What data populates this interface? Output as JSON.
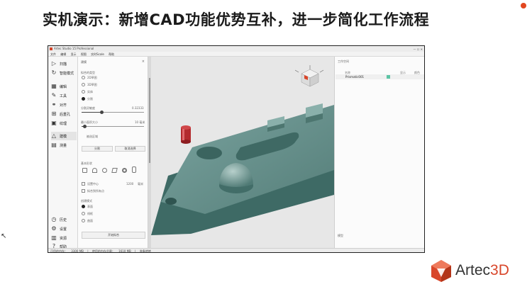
{
  "slide": {
    "title": "实机演示：新增CAD功能优势互补，进一步简化工作流程"
  },
  "app": {
    "window_title": "Artec Studio 15 Professional",
    "window_controls": "— ☐ ✕",
    "menu": [
      "文件",
      "编辑",
      "显示",
      "视图",
      "实时Scale",
      "帮助"
    ]
  },
  "toolbar": {
    "items": [
      {
        "label": "扫描",
        "icon": "play-icon"
      },
      {
        "label": "智能模式",
        "icon": "autopilot-icon"
      },
      {
        "label": "编辑",
        "icon": "edit-icon"
      },
      {
        "label": "工具",
        "icon": "tools-icon"
      },
      {
        "label": "对齐",
        "icon": "align-icon"
      },
      {
        "label": "后重孔",
        "icon": "fill-holes-icon"
      },
      {
        "label": "纹理",
        "icon": "texture-icon"
      },
      {
        "label": "建模",
        "icon": "cad-icon"
      },
      {
        "label": "测量",
        "icon": "measure-icon"
      },
      {
        "label": "历史",
        "icon": "history-icon"
      },
      {
        "label": "设置",
        "icon": "settings-icon"
      },
      {
        "label": "资源",
        "icon": "resources-icon"
      },
      {
        "label": "帮助",
        "icon": "help-icon"
      }
    ]
  },
  "panel": {
    "header": "建模",
    "close": "×",
    "section_mode": "拟合的类型",
    "modes": [
      "2D草图",
      "3D草图",
      "实体",
      "分割"
    ],
    "slider1_label": "分割灵敏度",
    "slider1_value": "0.32333",
    "slider1_fraction": 0.32,
    "slider2_label": "最小面积大小",
    "slider2_value": "10 毫米",
    "slider2_fraction": 0.05,
    "section_small": "被选区域",
    "btn_left": "分割",
    "btn_right": "取消选择",
    "section_shapes": "基本形状",
    "chk1_label": "设置中心",
    "chk1_value": "1200",
    "chk1_unit": "毫米",
    "chk2_label": "拟合到所有点",
    "section_create": "创建模式",
    "create_modes": [
      "表面",
      "线框",
      "曲面"
    ],
    "apply_button": "开始拟合"
  },
  "right_panel": {
    "header": "工作空间",
    "col_name": "名称",
    "col_a": "显示",
    "col_b": "颜色",
    "row_name": "Prismatic001",
    "swatch_color": "#5cc4a4",
    "footer": "模型"
  },
  "statusbar": {
    "items": [
      "可用的内存：",
      "3300 MB",
      "|",
      "使用的内存总量：",
      "1610 MB",
      "|",
      "准备就绪"
    ]
  },
  "brand": {
    "name": "Artec",
    "name_suffix": "3D",
    "accent_color": "#d8462a"
  }
}
